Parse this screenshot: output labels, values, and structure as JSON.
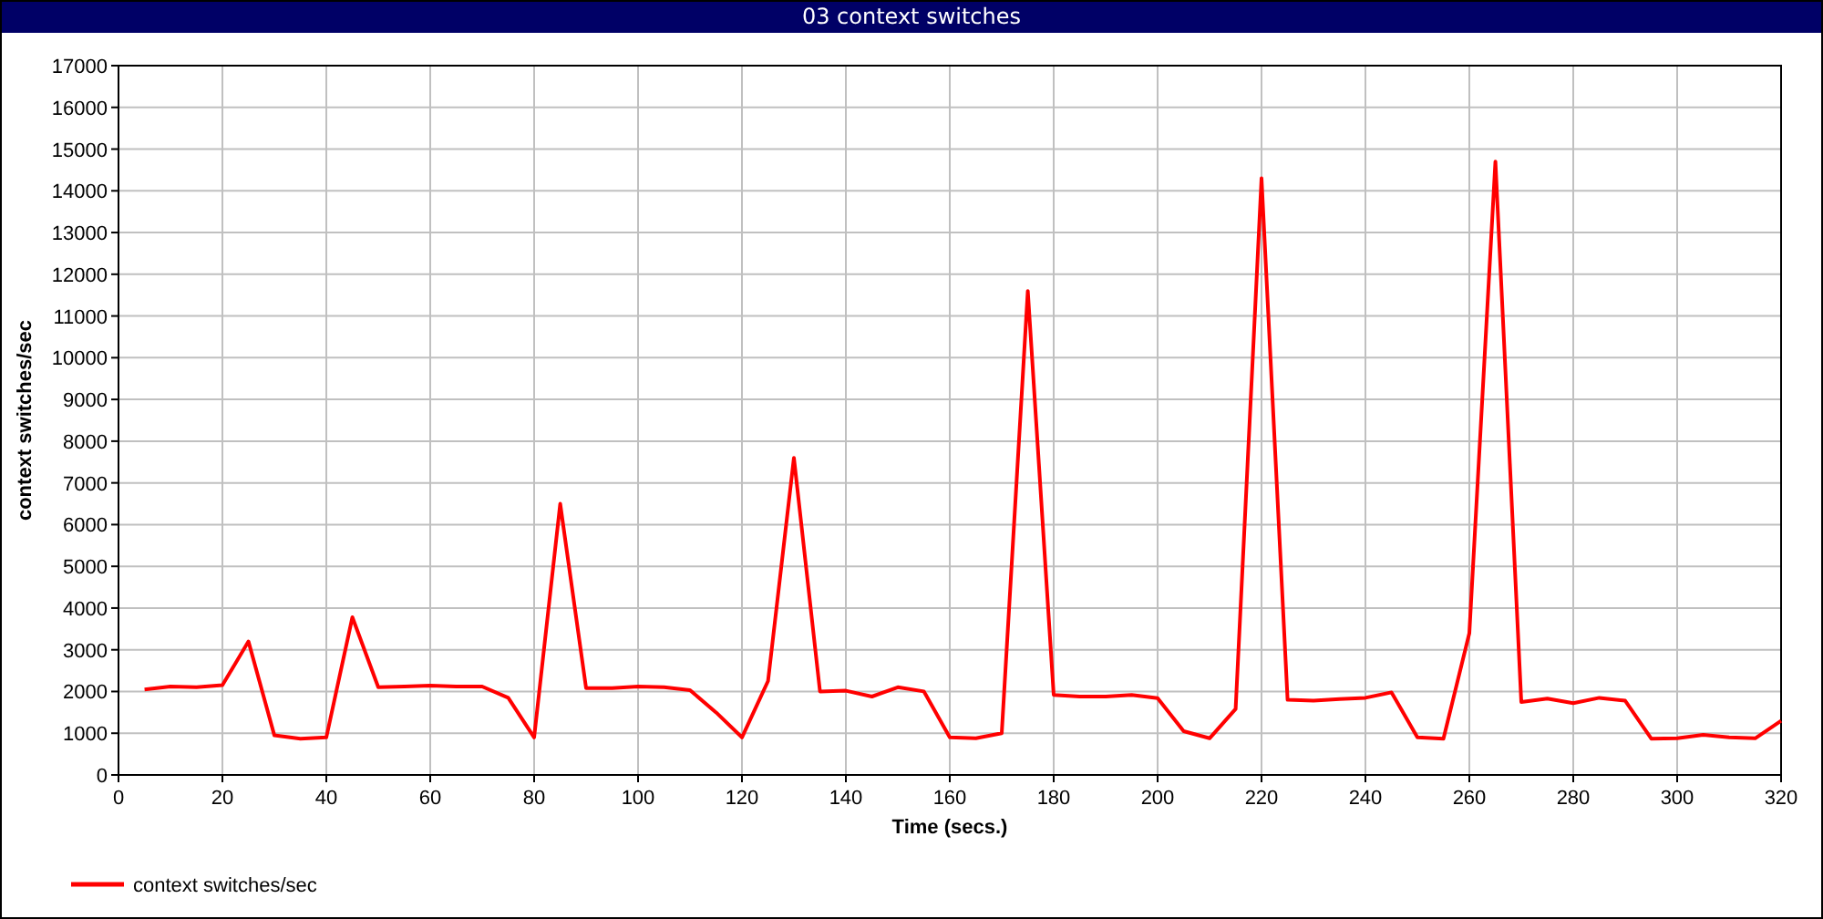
{
  "window": {
    "title": "03 context switches"
  },
  "chart_data": {
    "type": "line",
    "grid": true,
    "xlabel": "Time (secs.)",
    "ylabel": "context switches/sec",
    "xlim": [
      0,
      320
    ],
    "ylim": [
      0,
      17000
    ],
    "xticks": [
      0,
      20,
      40,
      60,
      80,
      100,
      120,
      140,
      160,
      180,
      200,
      220,
      240,
      260,
      280,
      300,
      320
    ],
    "yticks": [
      0,
      1000,
      2000,
      3000,
      4000,
      5000,
      6000,
      7000,
      8000,
      9000,
      10000,
      11000,
      12000,
      13000,
      14000,
      15000,
      16000,
      17000
    ],
    "x": [
      5,
      10,
      15,
      20,
      25,
      30,
      35,
      40,
      45,
      50,
      55,
      60,
      65,
      70,
      75,
      80,
      85,
      90,
      95,
      100,
      105,
      110,
      115,
      120,
      125,
      130,
      135,
      140,
      145,
      150,
      155,
      160,
      165,
      170,
      175,
      180,
      185,
      190,
      195,
      200,
      205,
      210,
      215,
      220,
      225,
      230,
      235,
      240,
      245,
      250,
      255,
      260,
      265,
      270,
      275,
      280,
      285,
      290,
      295,
      300,
      305,
      310,
      315,
      320
    ],
    "series": [
      {
        "name": "context switches/sec",
        "color": "#ff0000",
        "values": [
          2050,
          2120,
          2100,
          2150,
          3200,
          950,
          870,
          900,
          3780,
          2100,
          2120,
          2140,
          2120,
          2120,
          1850,
          900,
          6500,
          2080,
          2080,
          2120,
          2100,
          2030,
          1500,
          900,
          2250,
          7600,
          2000,
          2020,
          1880,
          2100,
          2000,
          900,
          880,
          1000,
          11600,
          1920,
          1880,
          1880,
          1920,
          1840,
          1050,
          880,
          1580,
          14300,
          1800,
          1780,
          1820,
          1850,
          1980,
          900,
          870,
          3400,
          14700,
          1750,
          1830,
          1720,
          1850,
          1780,
          870,
          880,
          960,
          900,
          880,
          1300
        ]
      }
    ]
  }
}
